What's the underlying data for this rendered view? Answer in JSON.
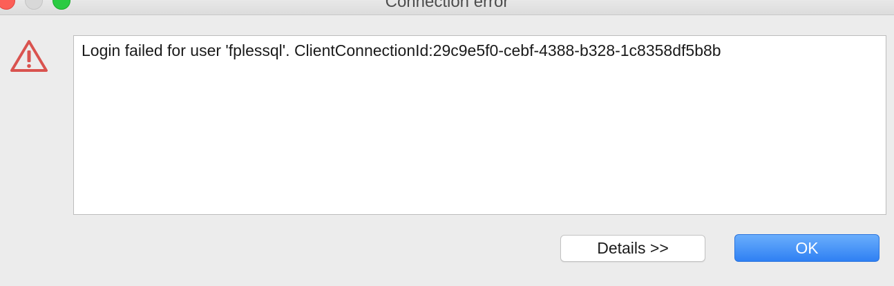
{
  "window": {
    "title": "Connection error"
  },
  "icons": {
    "warning": "warning-triangle-icon",
    "warning_color": "#d9534f"
  },
  "message": {
    "text": "Login failed for user 'fplessql'. ClientConnectionId:29c9e5f0-cebf-4388-b328-1c8358df5b8b"
  },
  "buttons": {
    "details_label": "Details >>",
    "ok_label": "OK"
  },
  "colors": {
    "accent": "#2f80f3",
    "close": "#fc5f57",
    "zoom": "#2acb42"
  }
}
